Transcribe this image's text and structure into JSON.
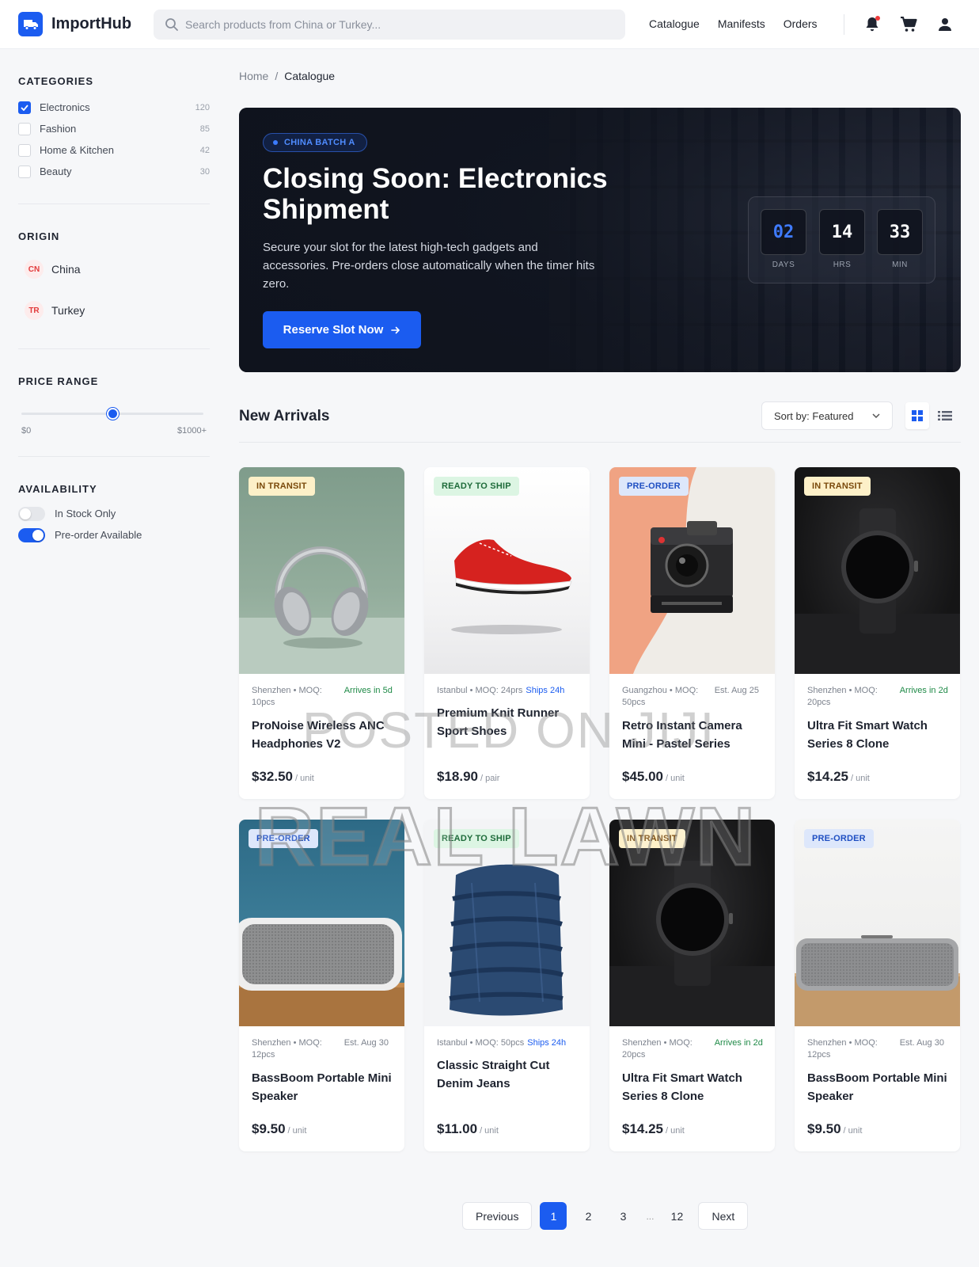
{
  "app": {
    "name": "ImportHub"
  },
  "search": {
    "placeholder": "Search products from China or Turkey..."
  },
  "nav": {
    "catalogue": "Catalogue",
    "manifests": "Manifests",
    "orders": "Orders"
  },
  "sidebar": {
    "categories_title": "CATEGORIES",
    "categories": [
      {
        "label": "Electronics",
        "count": "120",
        "checked": true
      },
      {
        "label": "Fashion",
        "count": "85",
        "checked": false
      },
      {
        "label": "Home & Kitchen",
        "count": "42",
        "checked": false
      },
      {
        "label": "Beauty",
        "count": "30",
        "checked": false
      }
    ],
    "origin_title": "ORIGIN",
    "origins": [
      {
        "code": "CN",
        "label": "China"
      },
      {
        "code": "TR",
        "label": "Turkey"
      }
    ],
    "price_title": "PRICE RANGE",
    "price_min": "$0",
    "price_max": "$1000+",
    "price_value_fraction": 0.5,
    "availability_title": "AVAILABILITY",
    "toggles": [
      {
        "label": "In Stock Only",
        "on": false
      },
      {
        "label": "Pre-order Available",
        "on": true
      }
    ]
  },
  "breadcrumb": {
    "home": "Home",
    "sep": "/",
    "current": "Catalogue"
  },
  "hero": {
    "pill": "CHINA BATCH A",
    "title": "Closing Soon: Electronics Shipment",
    "description": "Secure your slot for the latest high-tech gadgets and accessories. Pre-orders close automatically when the timer hits zero.",
    "button": "Reserve Slot Now",
    "timer": [
      {
        "value": "02",
        "label": "DAYS"
      },
      {
        "value": "14",
        "label": "HRS"
      },
      {
        "value": "33",
        "label": "MIN"
      }
    ]
  },
  "section": {
    "title": "New Arrivals",
    "sort": "Sort by: Featured"
  },
  "products": [
    {
      "badge": "IN TRANSIT",
      "badge_type": "transit",
      "origin": "Shenzhen • MOQ: 10pcs",
      "eta": "Arrives in 5d",
      "eta_color": "green",
      "name": "ProNoise Wireless ANC Headphones V2",
      "price": "$32.50",
      "unit": "/ unit",
      "image": "headphones"
    },
    {
      "badge": "READY TO SHIP",
      "badge_type": "ready",
      "origin": "Istanbul • MOQ: 24prs",
      "eta": "Ships 24h",
      "eta_color": "blue",
      "name": "Premium Knit Runner Sport Shoes",
      "price": "$18.90",
      "unit": "/ pair",
      "image": "shoe"
    },
    {
      "badge": "PRE-ORDER",
      "badge_type": "pre",
      "origin": "Guangzhou • MOQ: 50pcs",
      "eta": "Est. Aug 25",
      "eta_color": "gray",
      "name": "Retro Instant Camera Mini - Pastel Series",
      "price": "$45.00",
      "unit": "/ unit",
      "image": "camera"
    },
    {
      "badge": "IN TRANSIT",
      "badge_type": "transit",
      "origin": "Shenzhen • MOQ: 20pcs",
      "eta": "Arrives in 2d",
      "eta_color": "green",
      "name": "Ultra Fit Smart Watch Series 8 Clone",
      "price": "$14.25",
      "unit": "/ unit",
      "image": "watch"
    },
    {
      "badge": "PRE-ORDER",
      "badge_type": "pre",
      "origin": "Shenzhen • MOQ: 12pcs",
      "eta": "Est. Aug 30",
      "eta_color": "gray",
      "name": "BassBoom Portable Mini Speaker",
      "price": "$9.50",
      "unit": "/ unit",
      "image": "speaker-blue"
    },
    {
      "badge": "READY TO SHIP",
      "badge_type": "ready",
      "origin": "Istanbul • MOQ: 50pcs",
      "eta": "Ships 24h",
      "eta_color": "blue",
      "name": "Classic Straight Cut Denim Jeans",
      "price": "$11.00",
      "unit": "/ unit",
      "image": "jeans"
    },
    {
      "badge": "IN TRANSIT",
      "badge_type": "transit",
      "origin": "Shenzhen • MOQ: 20pcs",
      "eta": "Arrives in 2d",
      "eta_color": "green",
      "name": "Ultra Fit Smart Watch Series 8 Clone",
      "price": "$14.25",
      "unit": "/ unit",
      "image": "watch"
    },
    {
      "badge": "PRE-ORDER",
      "badge_type": "pre",
      "origin": "Shenzhen • MOQ: 12pcs",
      "eta": "Est. Aug 30",
      "eta_color": "gray",
      "name": "BassBoom Portable Mini Speaker",
      "price": "$9.50",
      "unit": "/ unit",
      "image": "speaker-wood"
    }
  ],
  "pagination": {
    "previous": "Previous",
    "pages": [
      "1",
      "2",
      "3",
      "...",
      "12"
    ],
    "active": "1",
    "next": "Next"
  },
  "watermark": {
    "line1": "POSTED ON JIJI",
    "line2": "REAL LAWN"
  },
  "colors": {
    "accent": "#1b5cf0",
    "hero_bg": "#141926",
    "transit": "#fdf0c8",
    "ready": "#dcf5e3",
    "pre_order": "#dde7fb"
  }
}
